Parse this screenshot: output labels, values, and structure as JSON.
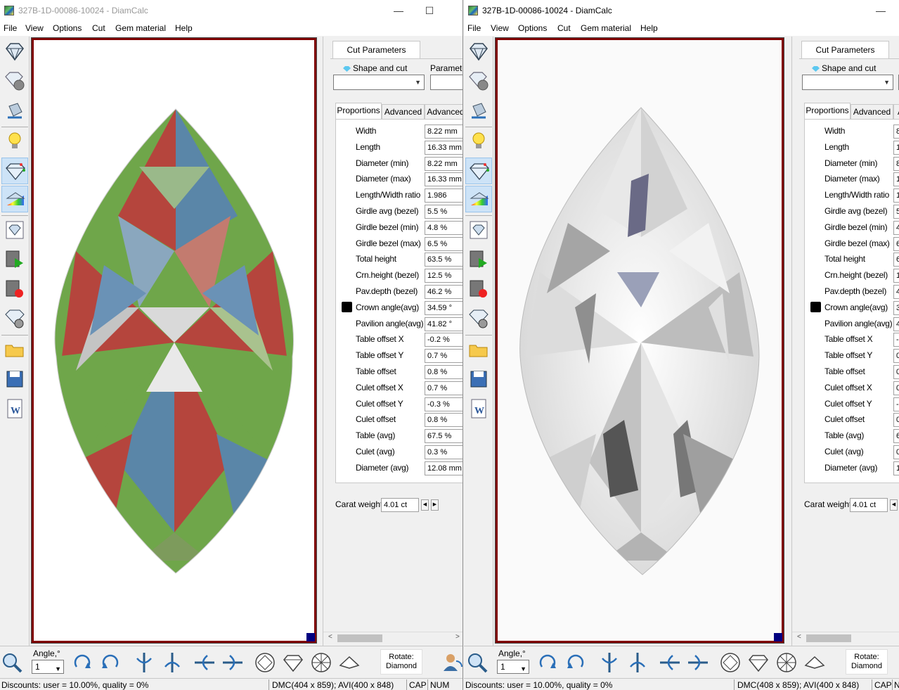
{
  "windows": [
    {
      "title": "327B-1D-00086-10024 - DiamCalc",
      "menu": [
        "File",
        "View",
        "Options",
        "Cut",
        "Gem material",
        "Help"
      ],
      "cut_params_tab": "Cut Parameters",
      "shape_label": "Shape and cut",
      "parameters_label": "Parameter",
      "subtabs": [
        "Proportions",
        "Advanced",
        "Advanced"
      ],
      "props": [
        {
          "label": "Width",
          "value": "8.22 mm"
        },
        {
          "label": "Length",
          "value": "16.33 mm"
        },
        {
          "label": "Diameter (min)",
          "value": "8.22 mm"
        },
        {
          "label": "Diameter (max)",
          "value": "16.33 mm"
        },
        {
          "label": "Length/Width ratio",
          "value": "1.986"
        },
        {
          "label": "Girdle avg (bezel)",
          "value": "5.5 %"
        },
        {
          "label": "Girdle bezel (min)",
          "value": "4.8 %"
        },
        {
          "label": "Girdle bezel (max)",
          "value": "6.5 %"
        },
        {
          "label": "Total height",
          "value": "63.5 %"
        },
        {
          "label": "Crn.height (bezel)",
          "value": "12.5 %"
        },
        {
          "label": "Pav.depth (bezel)",
          "value": "46.2 %"
        },
        {
          "label": "Crown angle(avg)",
          "value": "34.59 °"
        },
        {
          "label": "Pavilion angle(avg)",
          "value": "41.82 °"
        },
        {
          "label": "Table offset X",
          "value": "-0.2 %"
        },
        {
          "label": "Table offset Y",
          "value": "0.7 %"
        },
        {
          "label": "Table offset",
          "value": "0.8 %"
        },
        {
          "label": "Culet offset X",
          "value": "0.7 %"
        },
        {
          "label": "Culet offset Y",
          "value": "-0.3 %"
        },
        {
          "label": "Culet offset",
          "value": "0.8 %"
        },
        {
          "label": "Table (avg)",
          "value": "67.5 %"
        },
        {
          "label": "Culet (avg)",
          "value": "0.3 %"
        },
        {
          "label": "Diameter (avg)",
          "value": "12.08 mm"
        }
      ],
      "carat_label": "Carat weight",
      "carat_value": "4.01 ct",
      "angle_label": "Angle,°",
      "angle_value": "1",
      "rotate_label": "Rotate:",
      "rotate_value": "Diamond",
      "status": {
        "discounts": "Discounts: user = 10.00%, quality = 0%",
        "dims": "DMC(404 x 859); AVI(400 x 848)",
        "cap": "CAP",
        "num": "NUM"
      }
    },
    {
      "title": "327B-1D-00086-10024 - DiamCalc",
      "menu": [
        "File",
        "View",
        "Options",
        "Cut",
        "Gem material",
        "Help"
      ],
      "cut_params_tab": "Cut Parameters",
      "shape_label": "Shape and cut",
      "subtabs": [
        "Proportions",
        "Advanced",
        "A"
      ],
      "props": [
        {
          "label": "Width",
          "value": "8"
        },
        {
          "label": "Length",
          "value": "1"
        },
        {
          "label": "Diameter (min)",
          "value": "8"
        },
        {
          "label": "Diameter (max)",
          "value": "1"
        },
        {
          "label": "Length/Width ratio",
          "value": "1"
        },
        {
          "label": "Girdle avg (bezel)",
          "value": "5"
        },
        {
          "label": "Girdle bezel (min)",
          "value": "4"
        },
        {
          "label": "Girdle bezel (max)",
          "value": "6"
        },
        {
          "label": "Total height",
          "value": "6"
        },
        {
          "label": "Crn.height (bezel)",
          "value": "1"
        },
        {
          "label": "Pav.depth (bezel)",
          "value": "4"
        },
        {
          "label": "Crown angle(avg)",
          "value": "3"
        },
        {
          "label": "Pavilion angle(avg)",
          "value": "4"
        },
        {
          "label": "Table offset X",
          "value": "-("
        },
        {
          "label": "Table offset Y",
          "value": "0"
        },
        {
          "label": "Table offset",
          "value": "0"
        },
        {
          "label": "Culet offset X",
          "value": "0"
        },
        {
          "label": "Culet offset Y",
          "value": "-("
        },
        {
          "label": "Culet offset",
          "value": "0"
        },
        {
          "label": "Table (avg)",
          "value": "6"
        },
        {
          "label": "Culet (avg)",
          "value": "0"
        },
        {
          "label": "Diameter (avg)",
          "value": "1"
        }
      ],
      "carat_label": "Carat weight",
      "carat_value": "4.01 ct",
      "angle_label": "Angle,°",
      "angle_value": "1",
      "rotate_label": "Rotate:",
      "rotate_value": "Diamond",
      "status": {
        "discounts": "Discounts: user = 10.00%, quality = 0%",
        "dims": "DMC(408 x 859); AVI(400 x 848)",
        "cap": "CAP",
        "num": "N"
      }
    }
  ],
  "icons": {
    "left_toolbar": [
      "diamond-view-icon",
      "diamond-sphere-icon",
      "paint-bucket-icon",
      "light-bulb-icon",
      "diamond-sparkle-icon",
      "spectrum-icon",
      "diamond-image-icon",
      "video-play-icon",
      "video-record-icon",
      "diamond-gear-icon",
      "open-folder-icon",
      "save-icon",
      "word-document-icon"
    ],
    "bottom_toolbar": [
      "zoom-icon",
      "rotate-cw-icon",
      "rotate-ccw-icon",
      "flip-vertical-icon",
      "flip-vertical-alt-icon",
      "flip-horizontal-icon",
      "flip-horizontal-alt-icon",
      "top-view-icon",
      "side-view-icon",
      "bottom-view-icon",
      "diamond-outline-icon",
      "person-rotate-icon"
    ]
  },
  "colors": {
    "frame_border": "#800000",
    "corner_marker": "#000080",
    "gem_red": "#b5453d",
    "gem_green": "#6fa64a",
    "gem_blue": "#5a86a8"
  }
}
